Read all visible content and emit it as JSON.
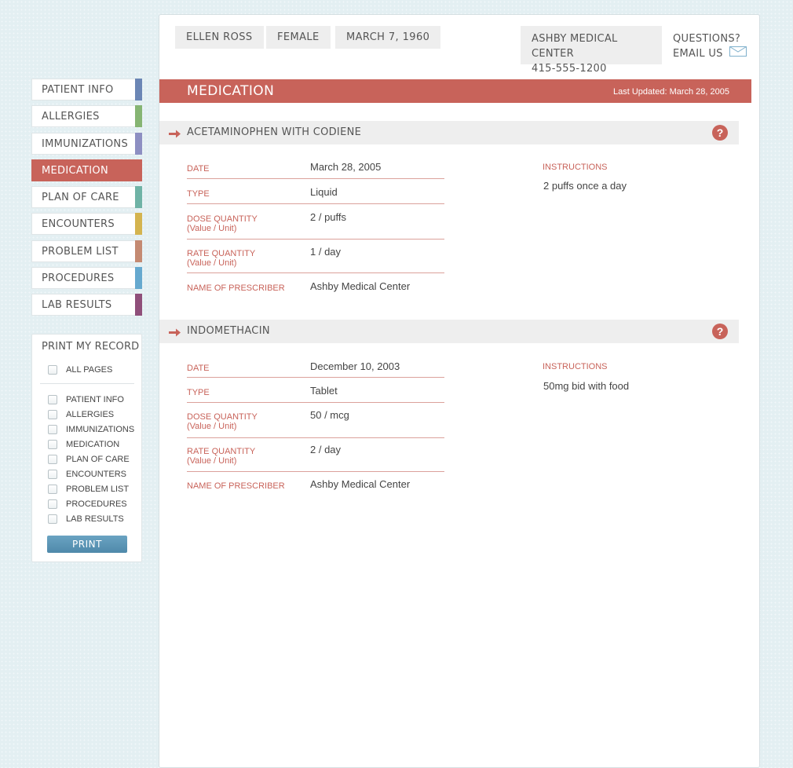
{
  "header": {
    "patient_name": "ELLEN ROSS",
    "gender": "FEMALE",
    "dob": "MARCH 7, 1960",
    "center_name": "ASHBY MEDICAL CENTER",
    "center_phone": "415-555-1200",
    "questions": "QUESTIONS?",
    "email_us": "EMAIL US"
  },
  "nav": {
    "items": [
      {
        "label": "PATIENT INFO",
        "color": "#6b86b5"
      },
      {
        "label": "ALLERGIES",
        "color": "#86b573"
      },
      {
        "label": "IMMUNIZATIONS",
        "color": "#8d8fc2"
      },
      {
        "label": "MEDICATION",
        "color": "#c8635a"
      },
      {
        "label": "PLAN OF CARE",
        "color": "#6fb3a6"
      },
      {
        "label": "ENCOUNTERS",
        "color": "#d4b44f"
      },
      {
        "label": "PROBLEM LIST",
        "color": "#c48a72"
      },
      {
        "label": "PROCEDURES",
        "color": "#66a9cf"
      },
      {
        "label": "LAB RESULTS",
        "color": "#8f4f7a"
      }
    ],
    "active": "MEDICATION"
  },
  "print": {
    "title": "PRINT MY RECORD",
    "all_pages": "ALL PAGES",
    "pages": [
      "PATIENT INFO",
      "ALLERGIES",
      "IMMUNIZATIONS",
      "MEDICATION",
      "PLAN OF CARE",
      "ENCOUNTERS",
      "PROBLEM LIST",
      "PROCEDURES",
      "LAB RESULTS"
    ],
    "button": "PRINT"
  },
  "section": {
    "title": "MEDICATION",
    "last_updated": "Last Updated: March 28, 2005"
  },
  "labels": {
    "date": "DATE",
    "type": "TYPE",
    "dose": "DOSE QUANTITY",
    "rate": "RATE QUANTITY",
    "value_unit": "(Value / Unit)",
    "prescriber": "NAME OF PRESCRIBER",
    "instructions": "INSTRUCTIONS"
  },
  "medications": [
    {
      "name": "ACETAMINOPHEN WITH CODIENE",
      "date": "March 28, 2005",
      "type": "Liquid",
      "dose": "2 / puffs",
      "rate": "1 / day",
      "prescriber": "Ashby Medical Center",
      "instructions": "2 puffs once a day"
    },
    {
      "name": "INDOMETHACIN",
      "date": "December 10, 2003",
      "type": "Tablet",
      "dose": "50 / mcg",
      "rate": "2 / day",
      "prescriber": "Ashby Medical Center",
      "instructions": "50mg bid with food"
    }
  ],
  "colors": {
    "accent": "#c8635a",
    "print_button": "#5a95b6"
  }
}
